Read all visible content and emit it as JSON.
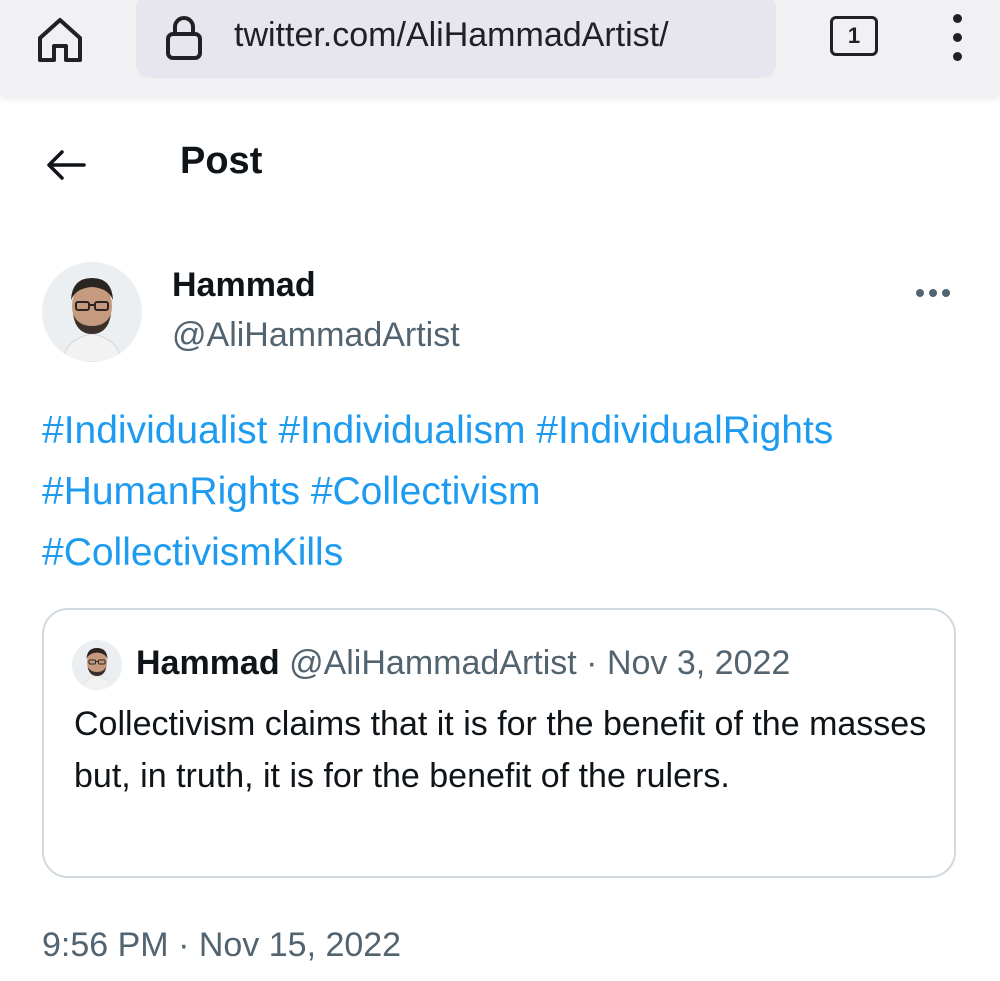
{
  "browser": {
    "url": "twitter.com/AliHammadArtist/",
    "tab_count": "1",
    "icons": [
      "home-icon",
      "lock-icon",
      "tabs-icon",
      "overflow-menu-icon"
    ]
  },
  "header": {
    "title": "Post",
    "back_icon": "arrow-left-icon"
  },
  "post": {
    "author_name": "Hammad",
    "author_handle": "@AliHammadArtist",
    "hashtags": [
      "#Individualist",
      "#Individualism",
      "#IndividualRights",
      "#HumanRights",
      "#Collectivism",
      "#CollectivismKills"
    ],
    "timestamp": "9:56 PM · Nov 15, 2022"
  },
  "quote": {
    "author_name": "Hammad",
    "meta": "@AliHammadArtist · Nov 3, 2022",
    "text": "Collectivism claims that it is for the benefit of the masses but, in truth, it is for the benefit of the rulers."
  },
  "colors": {
    "link": "#1d9bf0",
    "secondary_text": "#536471",
    "primary_text": "#0f1419",
    "border": "#cfd9de"
  }
}
